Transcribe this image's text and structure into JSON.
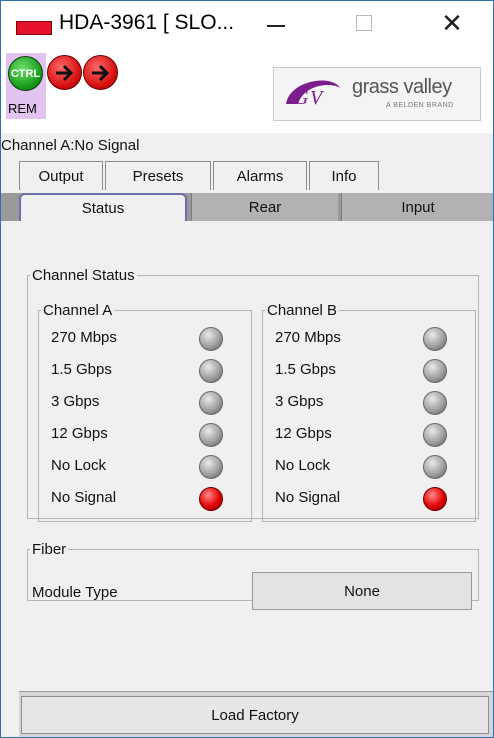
{
  "window": {
    "title": "HDA-3961 [ SLO...",
    "minimize_icon": "minimize-icon",
    "maximize_icon": "maximize-icon",
    "close_glyph": "✕"
  },
  "header": {
    "ctrl_label": "CTRL",
    "rem_label": "REM",
    "logo_text": "grass valley",
    "logo_sub": "A BELDEN BRAND",
    "colors": {
      "ctrl_green": "#179a17",
      "arrow_red": "#d60d0d",
      "logo_purple": "#7a1e8c"
    }
  },
  "channel_title": "Channel A:No Signal",
  "tabs_top": [
    "Output",
    "Presets",
    "Alarms",
    "Info"
  ],
  "tabs_bottom": {
    "active": "Status",
    "rear": "Rear",
    "input": "Input"
  },
  "channel_status": {
    "legend": "Channel Status",
    "channel_a": {
      "legend": "Channel A",
      "rows": [
        "270 Mbps",
        "1.5 Gbps",
        "3 Gbps",
        "12 Gbps",
        "No Lock",
        "No Signal"
      ],
      "states": [
        "off",
        "off",
        "off",
        "off",
        "off",
        "on"
      ]
    },
    "channel_b": {
      "legend": "Channel B",
      "rows": [
        "270 Mbps",
        "1.5 Gbps",
        "3 Gbps",
        "12 Gbps",
        "No Lock",
        "No Signal"
      ],
      "states": [
        "off",
        "off",
        "off",
        "off",
        "off",
        "on"
      ]
    }
  },
  "fiber": {
    "legend": "Fiber",
    "module_type_label": "Module Type",
    "module_type_value": "None"
  },
  "load_factory_label": "Load Factory"
}
